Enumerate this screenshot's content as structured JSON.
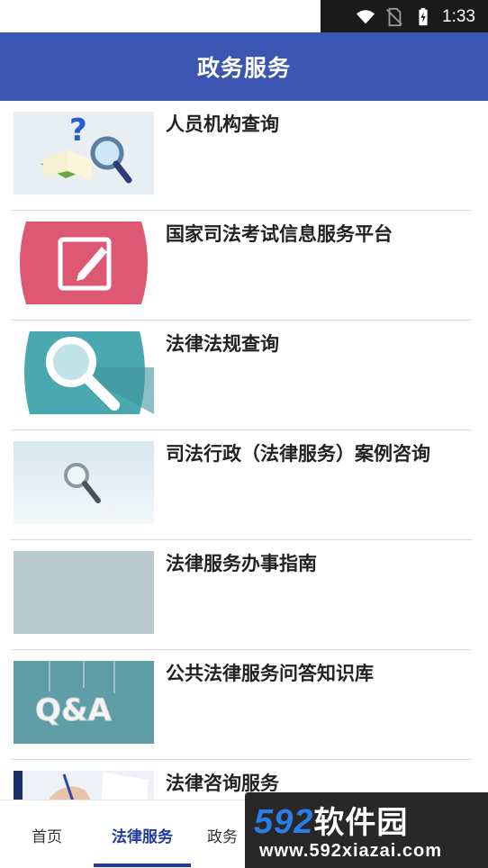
{
  "status_bar": {
    "time": "1:33"
  },
  "header": {
    "title": "政务服务"
  },
  "list": [
    {
      "label": "人员机构查询",
      "icon": "book-magnifier-icon"
    },
    {
      "label": "国家司法考试信息服务平台",
      "icon": "edit-pencil-icon"
    },
    {
      "label": "法律法规查询",
      "icon": "magnifier-icon"
    },
    {
      "label": "司法行政（法律服务）案例咨询",
      "icon": "magnifier-icon"
    },
    {
      "label": "法律服务办事指南",
      "icon": "blank-image-icon"
    },
    {
      "label": "公共法律服务问答知识库",
      "icon": "qa-icon"
    },
    {
      "label": "法律咨询服务",
      "icon": "writing-hand-icon"
    }
  ],
  "bottom_nav": {
    "tabs": [
      "首页",
      "法律服务",
      "政务"
    ],
    "active": "法律服务"
  },
  "watermark": {
    "line1_num": "592",
    "line1_cn": "软件园",
    "line2": "www.592xiazai.com"
  },
  "colors": {
    "appbar": "#3b55b0",
    "accent": "#1f3aa0"
  }
}
